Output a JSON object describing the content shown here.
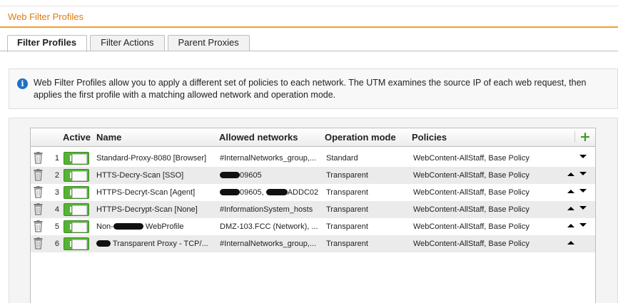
{
  "page": {
    "title": "Web Filter Profiles"
  },
  "tabs": [
    {
      "label": "Filter Profiles",
      "active": true
    },
    {
      "label": "Filter Actions",
      "active": false
    },
    {
      "label": "Parent Proxies",
      "active": false
    }
  ],
  "info": {
    "text": "Web Filter Profiles allow you to apply a different set of policies to each network. The UTM examines the source IP of each web request, then applies the first profile with a matching allowed network and operation mode."
  },
  "grid": {
    "columns": {
      "active": "Active",
      "name": "Name",
      "networks": "Allowed networks",
      "mode": "Operation mode",
      "policies": "Policies"
    },
    "rows": [
      {
        "num": "1",
        "name": "Standard-Proxy-8080 [Browser]",
        "networks": "#InternalNetworks_group,...",
        "mode": "Standard",
        "policies": "WebContent-AllStaff, Base Policy"
      },
      {
        "num": "2",
        "name": "HTTS-Decry-Scan [SSO]",
        "networks_suffix": "09605",
        "mode": "Transparent",
        "policies": "WebContent-AllStaff, Base Policy"
      },
      {
        "num": "3",
        "name": "HTTPS-Decryt-Scan [Agent]",
        "networks_mid": "09605,",
        "networks_suffix": "ADDC02",
        "mode": "Transparent",
        "policies": "WebContent-AllStaff, Base Policy"
      },
      {
        "num": "4",
        "name": "HTTPS-Decrypt-Scan [None]",
        "networks": "#InformationSystem_hosts",
        "mode": "Transparent",
        "policies": "WebContent-AllStaff, Base Policy"
      },
      {
        "num": "5",
        "name_prefix": "Non-",
        "name_suffix": "WebProfile",
        "networks": "DMZ-103.FCC (Network), ...",
        "mode": "Transparent",
        "policies": "WebContent-AllStaff, Base Policy"
      },
      {
        "num": "6",
        "name_suffix": "Transparent Proxy - TCP/...",
        "networks": "#InternalNetworks_group,...",
        "mode": "Transparent",
        "policies": "WebContent-AllStaff, Base Policy"
      }
    ]
  },
  "colors": {
    "accent": "#f0a030",
    "title": "#e07b10",
    "toggle_on": "#55b434",
    "add": "#3c9c28",
    "info": "#1f6fc5"
  },
  "icons": {
    "trash": "trash-icon",
    "add": "plus-icon",
    "up": "chevron-up-icon",
    "down": "chevron-down-icon",
    "info": "info-icon"
  }
}
